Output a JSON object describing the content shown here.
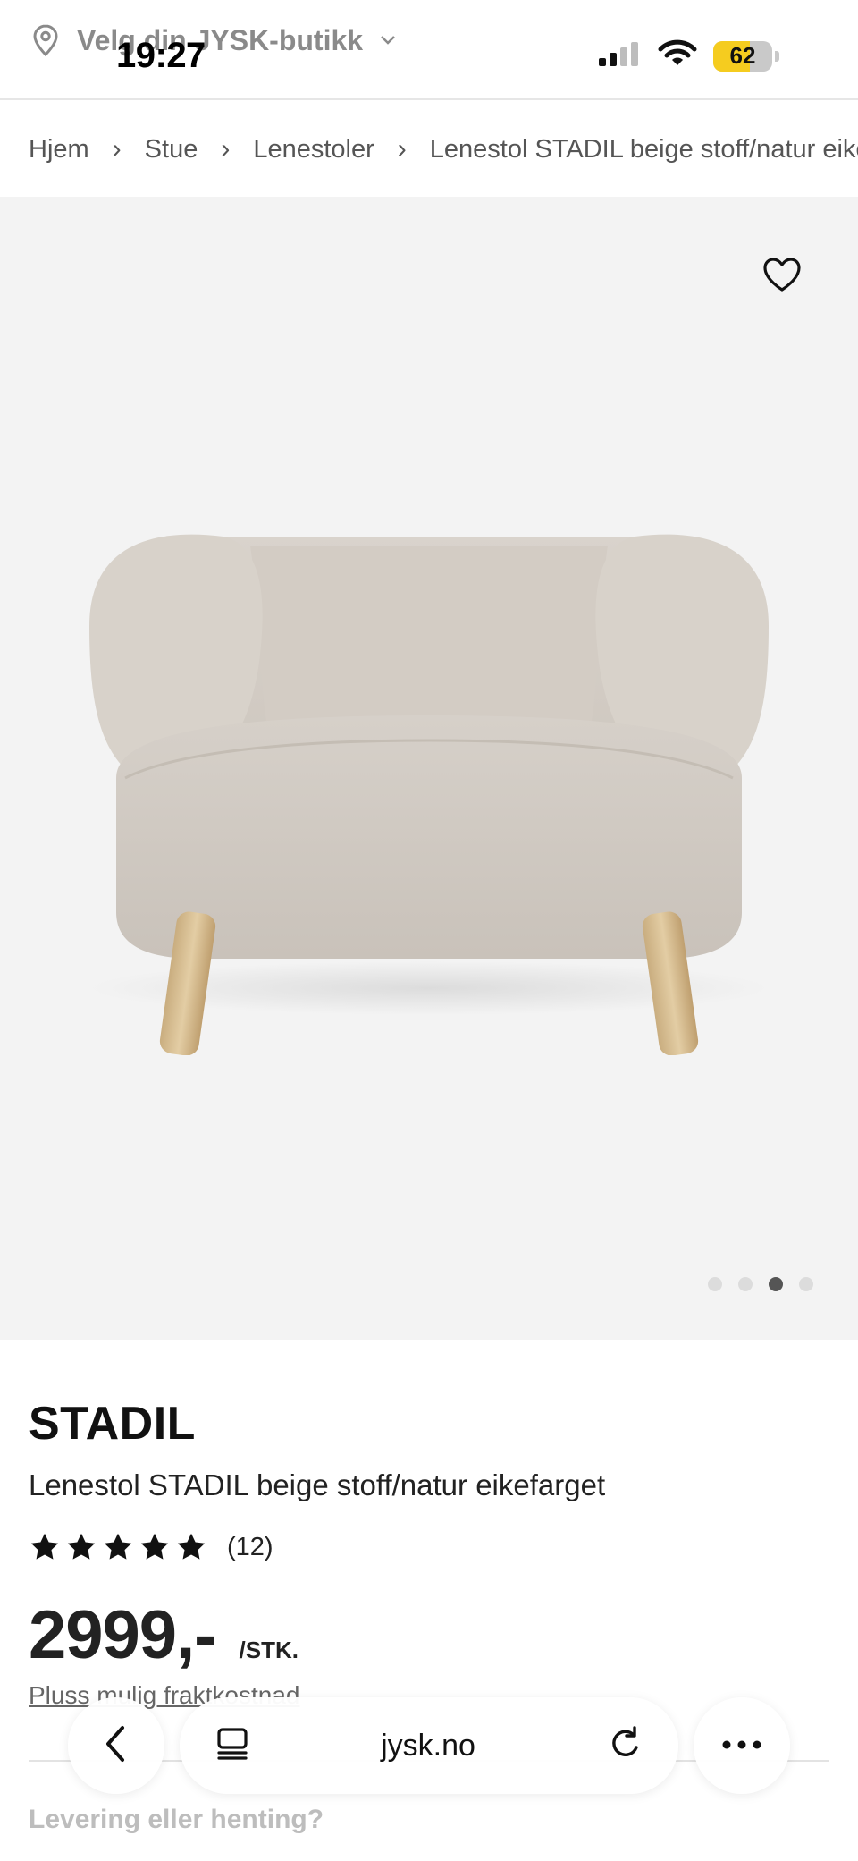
{
  "store_selector": {
    "label": "Velg din JYSK-butikk"
  },
  "status_bar": {
    "time": "19:27",
    "battery": "62",
    "battery_level": 0.62
  },
  "breadcrumb": [
    {
      "label": "Hjem"
    },
    {
      "label": "Stue"
    },
    {
      "label": "Lenestoler"
    },
    {
      "label": "Lenestol STADIL beige stoff/natur eikef"
    }
  ],
  "gallery": {
    "slides": 4,
    "active_index": 2
  },
  "product": {
    "brand": "STADIL",
    "name": "Lenestol STADIL beige stoff/natur eikefarget",
    "rating": {
      "stars": 5,
      "count_label": "(12)"
    },
    "price": "2999,-",
    "price_unit": "/STK.",
    "shipping_note": "Pluss mulig fraktkostnad",
    "delivery_heading": "Levering eller henting?"
  },
  "browser": {
    "url": "jysk.no"
  },
  "colors": {
    "battery_fill": "#f5cc1f",
    "star": "#111111",
    "hero_bg": "#f3f3f3"
  }
}
